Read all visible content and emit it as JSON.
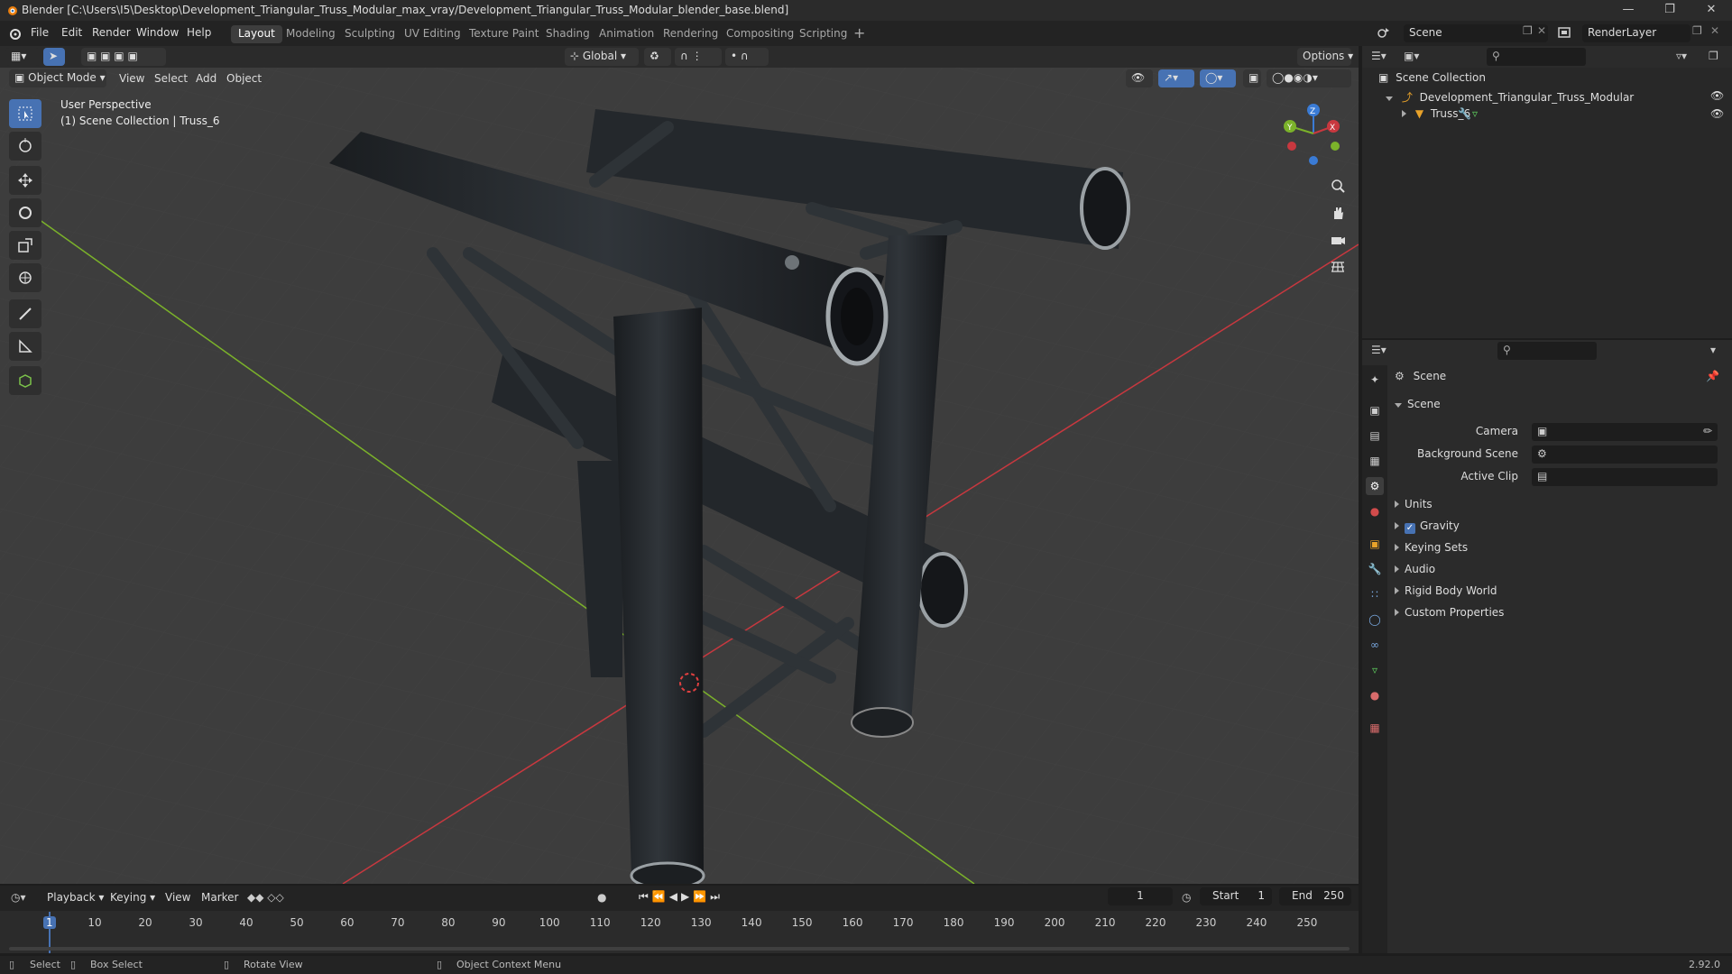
{
  "window": {
    "title": "Blender [C:\\Users\\I5\\Desktop\\Development_Triangular_Truss_Modular_max_vray/Development_Triangular_Truss_Modular_blender_base.blend]",
    "buttons": [
      "minimize",
      "maximize",
      "close"
    ]
  },
  "menu": [
    "File",
    "Edit",
    "Render",
    "Window",
    "Help"
  ],
  "workspaces": [
    "Layout",
    "Modeling",
    "Sculpting",
    "UV Editing",
    "Texture Paint",
    "Shading",
    "Animation",
    "Rendering",
    "Compositing",
    "Scripting"
  ],
  "active_workspace": "Layout",
  "scene_field": "Scene",
  "view_layer_field": "RenderLayer",
  "viewport": {
    "mode": "Object Mode",
    "menus": [
      "View",
      "Select",
      "Add",
      "Object"
    ],
    "transform_orientation": "Global",
    "options_label": "Options",
    "overlay_line1": "User Perspective",
    "overlay_line2": "(1) Scene Collection | Truss_6",
    "gizmo_axes": [
      "X",
      "Y",
      "Z"
    ],
    "colors": {
      "x_axis": "#c8383f",
      "y_axis": "#7bb22a",
      "z_axis": "#3a7bd5",
      "background": "#3d3d3d",
      "truss": "#262a2e"
    }
  },
  "tools": [
    "select-box",
    "cursor",
    "move",
    "rotate",
    "scale",
    "transform",
    "annotate",
    "measure",
    "add-cube"
  ],
  "outliner": {
    "root": "Scene Collection",
    "items": [
      {
        "name": "Development_Triangular_Truss_Modular",
        "depth": 1
      },
      {
        "name": "Truss_6",
        "depth": 2
      }
    ]
  },
  "properties": {
    "context": "Scene",
    "panel_title": "Scene",
    "fields": [
      {
        "label": "Camera",
        "value": ""
      },
      {
        "label": "Background Scene",
        "value": ""
      },
      {
        "label": "Active Clip",
        "value": ""
      }
    ],
    "subpanels": [
      "Units",
      "Gravity",
      "Keying Sets",
      "Audio",
      "Rigid Body World",
      "Custom Properties"
    ],
    "gravity_checked": true
  },
  "timeline": {
    "menus": [
      "Playback",
      "Keying",
      "View",
      "Marker"
    ],
    "current_frame": "1",
    "start_label": "Start",
    "start": "1",
    "end_label": "End",
    "end": "250",
    "ruler": [
      "1",
      "10",
      "20",
      "30",
      "40",
      "50",
      "60",
      "70",
      "80",
      "90",
      "100",
      "110",
      "120",
      "130",
      "140",
      "150",
      "160",
      "170",
      "180",
      "190",
      "200",
      "210",
      "220",
      "230",
      "240",
      "250"
    ]
  },
  "status": {
    "select": "Select",
    "box_select": "Box Select",
    "rotate_view": "Rotate View",
    "context_menu": "Object Context Menu",
    "version": "2.92.0"
  }
}
